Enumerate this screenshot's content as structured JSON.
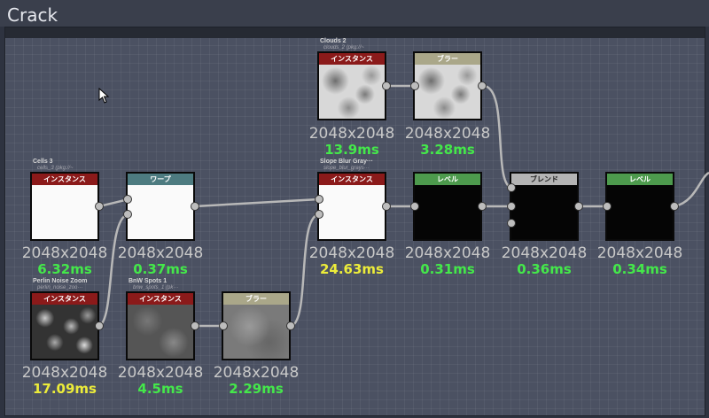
{
  "frame": {
    "title": "Crack"
  },
  "nodes": {
    "clouds2": {
      "label": "Clouds 2",
      "sub": "clouds_2 (pkg://~",
      "header": "インスタンス",
      "res": "2048x2048",
      "ms": "13.9ms"
    },
    "blur1": {
      "header": "ブラー",
      "res": "2048x2048",
      "ms": "3.28ms"
    },
    "cells3": {
      "label": "Cells 3",
      "sub": "cells_3 (pkg://~",
      "header": "インスタンス",
      "res": "2048x2048",
      "ms": "6.32ms"
    },
    "warp": {
      "header": "ワープ",
      "res": "2048x2048",
      "ms": "0.37ms"
    },
    "slope": {
      "label": "Slope Blur Gray···",
      "sub": "slope_blur_grays···",
      "header": "インスタンス",
      "res": "2048x2048",
      "ms": "24.63ms"
    },
    "level1": {
      "header": "レベル",
      "res": "2048x2048",
      "ms": "0.31ms"
    },
    "blend": {
      "header": "ブレンド",
      "res": "2048x2048",
      "ms": "0.36ms"
    },
    "level2": {
      "header": "レベル",
      "res": "2048x2048",
      "ms": "0.34ms"
    },
    "perlin": {
      "label": "Perlin Noise Zoom",
      "sub": "perlin_noise_zoo···",
      "header": "インスタンス",
      "res": "2048x2048",
      "ms": "17.09ms"
    },
    "bnw": {
      "label": "BnW Spots 1",
      "sub": "bnw_spots_1 (pk···",
      "header": "インスタンス",
      "res": "2048x2048",
      "ms": "4.5ms"
    },
    "blur2": {
      "header": "ブラー",
      "res": "2048x2048",
      "ms": "2.29ms"
    }
  }
}
